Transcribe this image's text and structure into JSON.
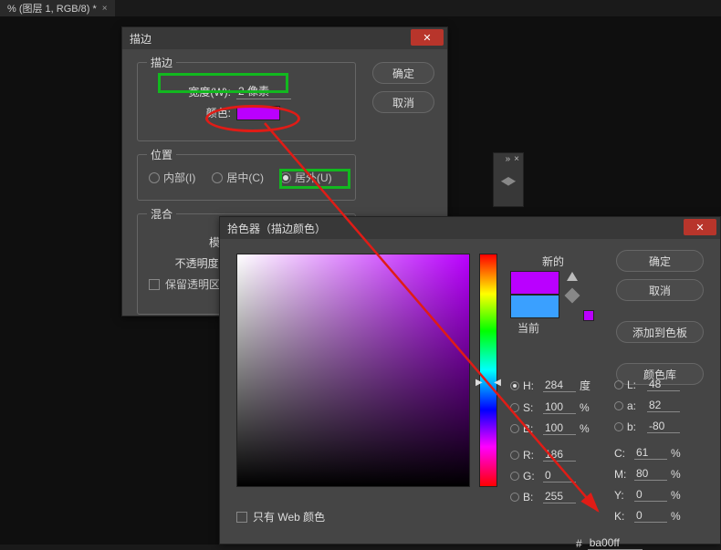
{
  "doc_tab": {
    "title": "% (图层 1, RGB/8) *"
  },
  "stroke_dialog": {
    "title": "描边",
    "ok": "确定",
    "cancel": "取消",
    "stroke_group": "描边",
    "width_label": "宽度(W):",
    "width_value": "2 像素",
    "color_label": "颜色:",
    "position_group": "位置",
    "pos_inside": "内部(I)",
    "pos_center": "居中(C)",
    "pos_outside": "居外(U)",
    "blend_group": "混合",
    "mode_label": "模式",
    "opacity_label": "不透明度(O",
    "preserve_label": "保留透明区"
  },
  "color_picker": {
    "title": "拾色器（描边颜色）",
    "ok": "确定",
    "cancel": "取消",
    "add_swatch": "添加到色板",
    "libraries": "颜色库",
    "new_label": "新的",
    "current_label": "当前",
    "new_color": "#ba00ff",
    "current_color": "#3aa0ff",
    "web_only": "只有 Web 颜色",
    "h": {
      "label": "H:",
      "value": "284",
      "unit": "度"
    },
    "s": {
      "label": "S:",
      "value": "100",
      "unit": "%"
    },
    "bb": {
      "label": "B:",
      "value": "100",
      "unit": "%"
    },
    "L": {
      "label": "L:",
      "value": "48"
    },
    "a": {
      "label": "a:",
      "value": "82"
    },
    "b": {
      "label": "b:",
      "value": "-80"
    },
    "r": {
      "label": "R:",
      "value": "186"
    },
    "g": {
      "label": "G:",
      "value": "0"
    },
    "b_rgb": {
      "label": "B:",
      "value": "255"
    },
    "c": {
      "label": "C:",
      "value": "61",
      "unit": "%"
    },
    "m": {
      "label": "M:",
      "value": "80",
      "unit": "%"
    },
    "y": {
      "label": "Y:",
      "value": "0",
      "unit": "%"
    },
    "k": {
      "label": "K:",
      "value": "0",
      "unit": "%"
    },
    "hex_label": "#",
    "hex_value": "ba00ff"
  }
}
